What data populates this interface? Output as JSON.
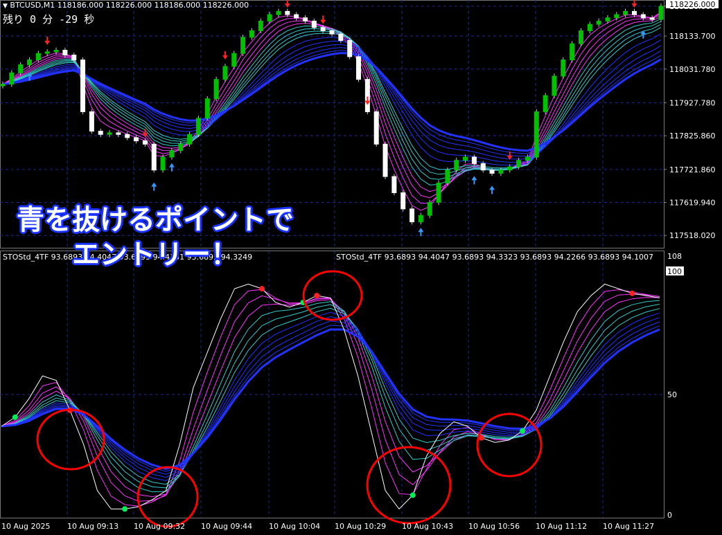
{
  "header": {
    "symbol_line": "BTCUSD,M1  118186.000 118226.000 118186.000 118226.000",
    "countdown": "残り 0 分 -29 秒"
  },
  "indicator": {
    "label_1": "STOStd_4TF 93.6893 94.4047 93.6893 94.4131 93.6893 94.3249",
    "label_2": "STOStd_4TF 93.6893 94.4047 93.6893 94.3323 93.6893 94.2266 93.6893 94.1007"
  },
  "annotation": {
    "line1": "青を抜けるポイントで",
    "line2": "エントリー！"
  },
  "colors": {
    "background": "#000000",
    "grid": "#1e2a8a",
    "bull": "#00c000",
    "bear": "#ffffff",
    "ribbon_magenta": "#ff33ff",
    "ribbon_cyan": "#33cccc",
    "ribbon_blue": "#2233ff",
    "highlight_circle": "#ff0000"
  },
  "chart_data": [
    {
      "type": "candlestick",
      "title": "BTCUSD,M1",
      "y_ticks": [
        "118226.000",
        "118133.700",
        "118031.780",
        "117927.780",
        "117825.860",
        "117721.860",
        "117619.940",
        "117518.020"
      ],
      "ylim": [
        117480,
        118245
      ],
      "current_price": "118226.000",
      "series_close": [
        117985,
        118020,
        118045,
        118060,
        118080,
        118085,
        118090,
        118075,
        118060,
        117900,
        117840,
        117830,
        117835,
        117830,
        117820,
        117810,
        117800,
        117720,
        117760,
        117780,
        117800,
        117830,
        117880,
        117940,
        118000,
        118040,
        118080,
        118130,
        118150,
        118180,
        118200,
        118210,
        118200,
        118190,
        118180,
        118160,
        118150,
        118140,
        118120,
        118070,
        118000,
        117900,
        117800,
        117700,
        117650,
        117600,
        117560,
        117580,
        117620,
        117680,
        117720,
        117750,
        117760,
        117740,
        117720,
        117710,
        117720,
        117730,
        117750,
        117760,
        117900,
        117950,
        118010,
        118060,
        118110,
        118150,
        118170,
        118180,
        118190,
        118200,
        118210,
        118200,
        118190,
        118185,
        118226
      ],
      "ribbon": "moving-average ribbon (magenta / cyan / blue)"
    },
    {
      "type": "line",
      "title": "STOStd_4TF",
      "y_ticks": [
        "108",
        "100",
        "50",
        "0"
      ],
      "ylim": [
        0,
        108
      ],
      "series_main": [
        38,
        42,
        50,
        60,
        58,
        45,
        30,
        10,
        2,
        2,
        3,
        6,
        10,
        30,
        55,
        70,
        85,
        98,
        100,
        98,
        92,
        90,
        92,
        95,
        94,
        80,
        60,
        35,
        10,
        2,
        8,
        25,
        35,
        40,
        38,
        33,
        31,
        32,
        36,
        45,
        60,
        75,
        88,
        95,
        100,
        98,
        96,
        95,
        94
      ],
      "x_ticks": [
        "10 Aug 2025",
        "10 Aug 09:13",
        "10 Aug 09:32",
        "10 Aug 09:44",
        "10 Aug 10:04",
        "10 Aug 10:29",
        "10 Aug 10:43",
        "10 Aug 10:56",
        "10 Aug 11:12",
        "10 Aug 11:27"
      ]
    }
  ]
}
